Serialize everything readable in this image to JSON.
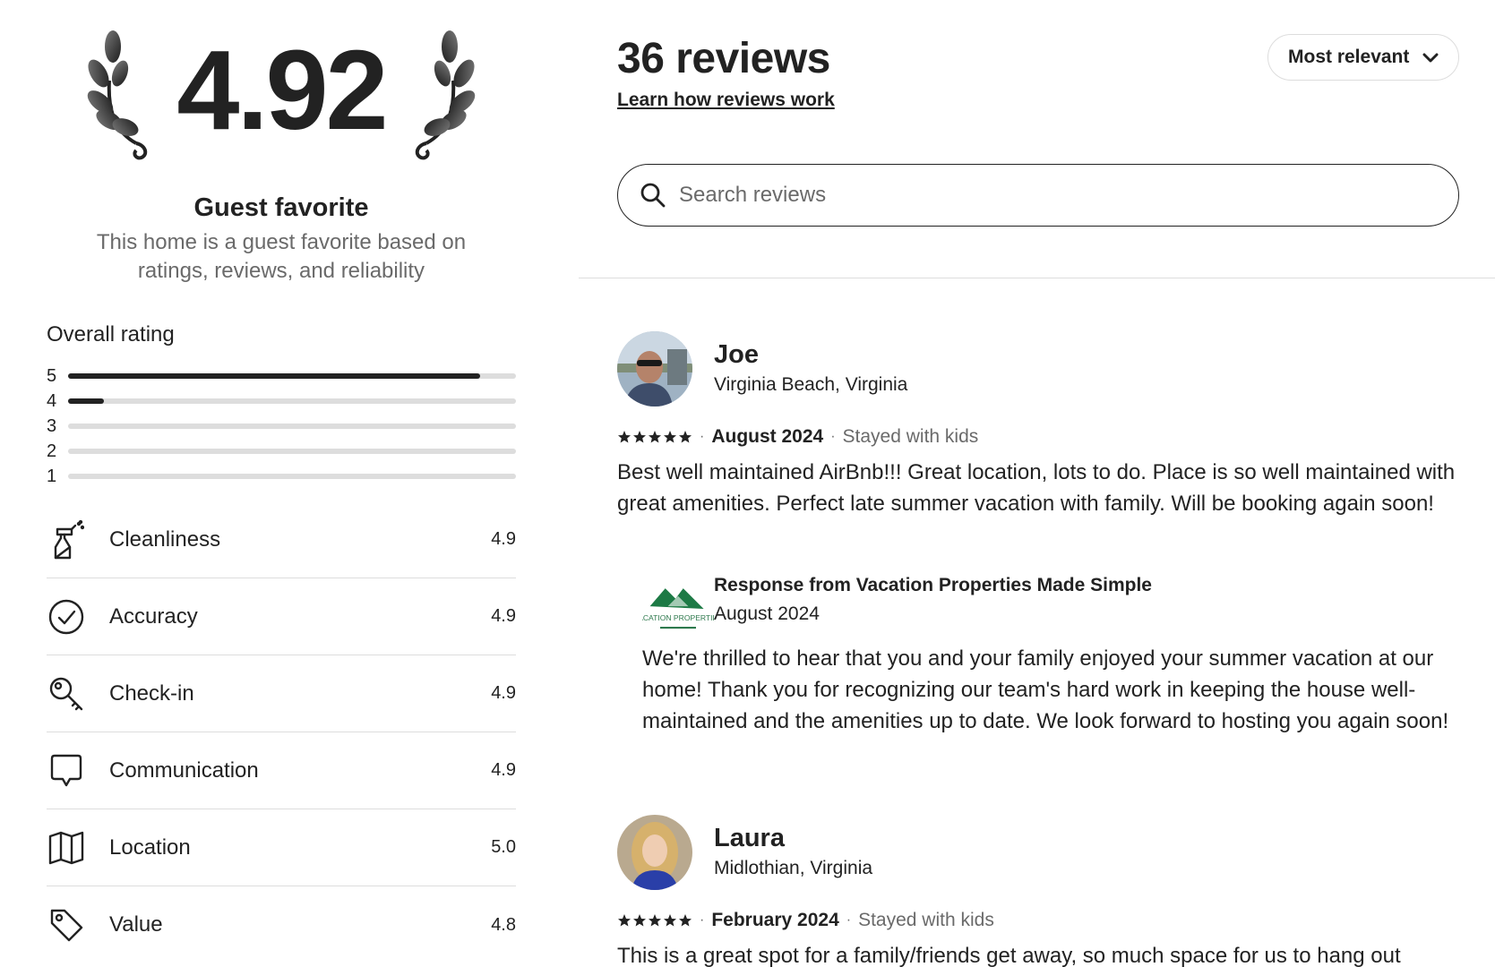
{
  "summary": {
    "rating": "4.92",
    "badge_title": "Guest favorite",
    "badge_subtitle": "This home is a guest favorite based on ratings, reviews, and reliability"
  },
  "overall": {
    "title": "Overall rating",
    "distribution": [
      {
        "stars": "5",
        "fraction": 0.92
      },
      {
        "stars": "4",
        "fraction": 0.08
      },
      {
        "stars": "3",
        "fraction": 0
      },
      {
        "stars": "2",
        "fraction": 0
      },
      {
        "stars": "1",
        "fraction": 0
      }
    ]
  },
  "categories": [
    {
      "label": "Cleanliness",
      "value": "4.9",
      "icon": "spray-bottle-icon"
    },
    {
      "label": "Accuracy",
      "value": "4.9",
      "icon": "check-circle-icon"
    },
    {
      "label": "Check-in",
      "value": "4.9",
      "icon": "key-icon"
    },
    {
      "label": "Communication",
      "value": "4.9",
      "icon": "chat-bubble-icon"
    },
    {
      "label": "Location",
      "value": "5.0",
      "icon": "map-icon"
    },
    {
      "label": "Value",
      "value": "4.8",
      "icon": "tag-icon"
    }
  ],
  "reviews_header": {
    "count": "36 reviews",
    "learn_link": "Learn how reviews work",
    "sort_label": "Most relevant",
    "search_placeholder": "Search reviews"
  },
  "reviews": [
    {
      "name": "Joe",
      "location": "Virginia Beach, Virginia",
      "stars": 5,
      "date": "August 2024",
      "stay": "Stayed with kids",
      "text": "Best well maintained AirBnb!!!  Great location, lots to do.  Place is so well maintained with great amenities.  Perfect late summer vacation with family.  Will be booking again soon!",
      "response": {
        "title": "Response from Vacation Properties Made Simple",
        "date": "August 2024",
        "text": "We're thrilled to hear that you and your family enjoyed your summer vacation at our home! Thank you for recognizing our team's hard work in keeping the house well-maintained and the amenities up to date. We look forward to hosting you again soon!"
      }
    },
    {
      "name": "Laura",
      "location": "Midlothian, Virginia",
      "stars": 5,
      "date": "February 2024",
      "stay": "Stayed with kids",
      "text": "This is a great spot for a family/friends get away, so much space for us to hang out"
    }
  ],
  "host_logo_text": "VACATION PROPERTIES"
}
